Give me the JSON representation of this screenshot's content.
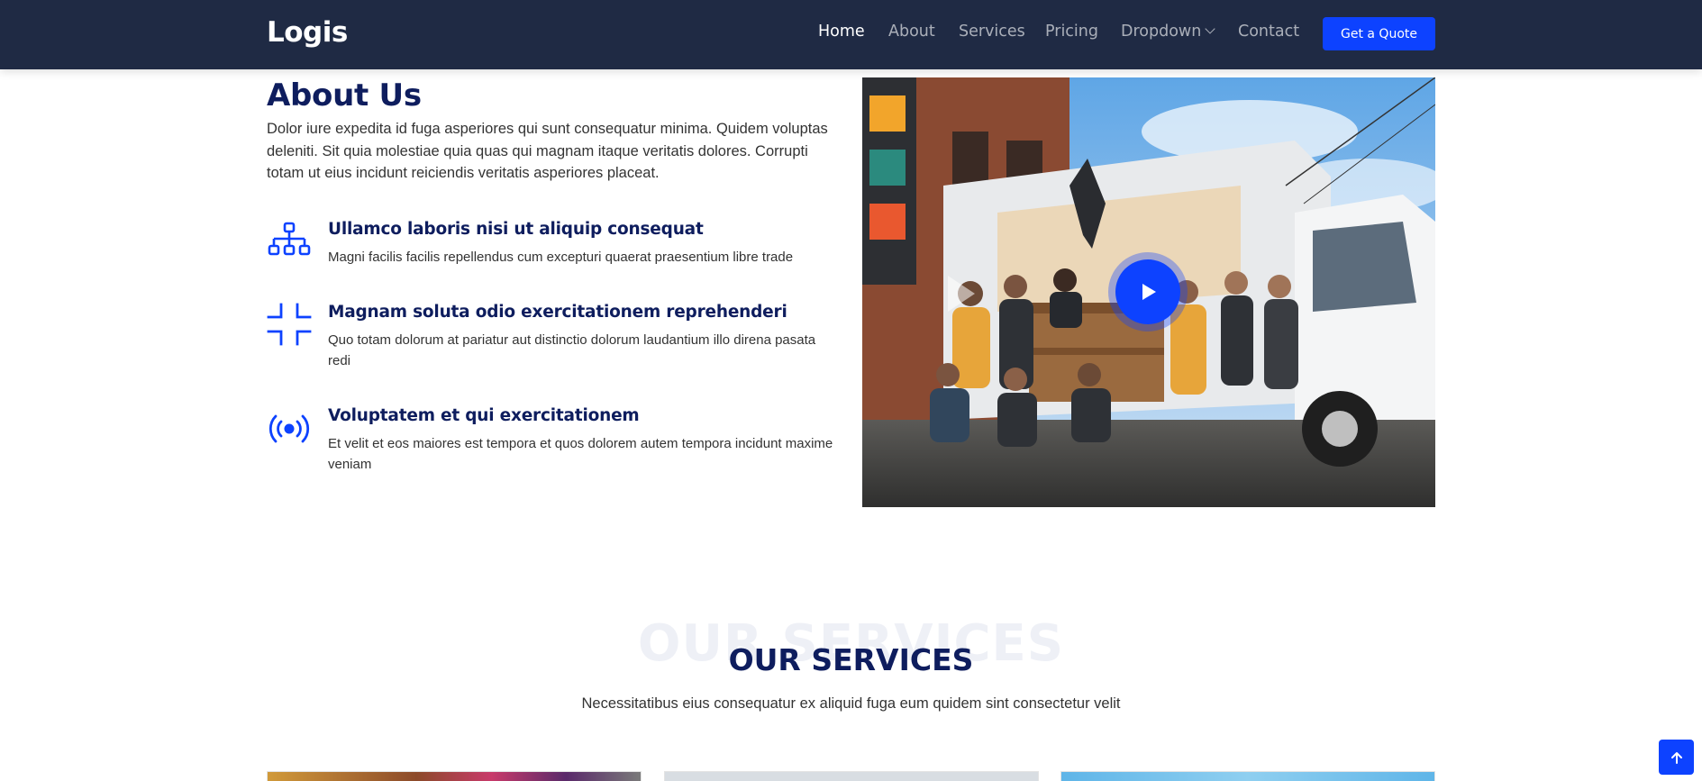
{
  "header": {
    "logo": "Logis",
    "nav": [
      {
        "label": "Home",
        "active": true
      },
      {
        "label": "About",
        "active": false
      },
      {
        "label": "Services",
        "active": false
      },
      {
        "label": "Pricing",
        "active": false
      },
      {
        "label": "Dropdown",
        "active": false,
        "has_dropdown": true
      },
      {
        "label": "Contact",
        "active": false
      }
    ],
    "cta": "Get a Quote"
  },
  "about": {
    "title": "About Us",
    "description": "Dolor iure expedita id fuga asperiores qui sunt consequatur minima. Quidem voluptas deleniti. Sit quia molestiae quia quas qui magnam itaque veritatis dolores. Corrupti totam ut eius incidunt reiciendis veritatis asperiores placeat.",
    "features": [
      {
        "icon": "diagram-3-icon",
        "title": "Ullamco laboris nisi ut aliquip consequat",
        "text": "Magni facilis facilis repellendus cum excepturi quaerat praesentium libre trade"
      },
      {
        "icon": "fullscreen-exit-icon",
        "title": "Magnam soluta odio exercitationem reprehenderi",
        "text": "Quo totam dolorum at pariatur aut distinctio dolorum laudantium illo direna pasata redi"
      },
      {
        "icon": "broadcast-icon",
        "title": "Voluptatem et qui exercitationem",
        "text": "Et velit et eos maiores est tempora et quos dolorem autem tempora incidunt maxime veniam"
      }
    ],
    "image_alt": "Movers in front of a moving truck"
  },
  "services": {
    "bg_title": "OUR SERVICES",
    "title": "OUR SERVICES",
    "subtitle": "Necessitatibus eius consequatur ex aliquid fuga eum quidem sint consectetur velit"
  },
  "colors": {
    "header_bg": "#1f2a44",
    "accent": "#0d42ff",
    "heading": "#0e1d5e"
  }
}
